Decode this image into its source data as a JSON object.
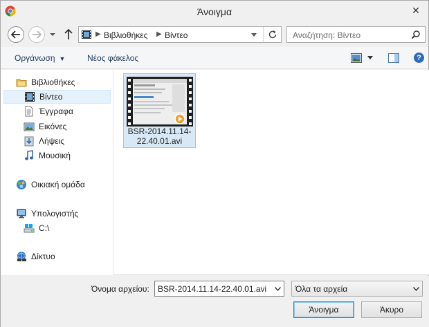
{
  "window": {
    "title": "Άνοιγμα",
    "app_icon": "chrome-icon",
    "close_icon": "close-icon"
  },
  "address_bar": {
    "segments": [
      "Βιβλιοθήκες",
      "Βίντεο"
    ],
    "location_icon": "video-library-icon"
  },
  "search": {
    "placeholder": "Αναζήτηση: Βίντεο"
  },
  "toolbar": {
    "organize_label": "Οργάνωση",
    "new_folder_label": "Νέος φάκελος"
  },
  "sidebar": {
    "items": [
      {
        "label": "Βιβλιοθήκες",
        "icon": "libraries-icon",
        "selected": false
      },
      {
        "label": "Βίντεο",
        "icon": "video-icon",
        "selected": true
      },
      {
        "label": "Έγγραφα",
        "icon": "documents-icon",
        "selected": false
      },
      {
        "label": "Εικόνες",
        "icon": "pictures-icon",
        "selected": false
      },
      {
        "label": "Λήψεις",
        "icon": "downloads-icon",
        "selected": false
      },
      {
        "label": "Μουσική",
        "icon": "music-icon",
        "selected": false
      },
      {
        "label": "Οικιακή ομάδα",
        "icon": "homegroup-icon",
        "selected": false
      },
      {
        "label": "Υπολογιστής",
        "icon": "computer-icon",
        "selected": false
      },
      {
        "label": "C:\\",
        "icon": "drive-icon",
        "selected": false
      },
      {
        "label": "Δίκτυο",
        "icon": "network-icon",
        "selected": false
      }
    ]
  },
  "files": [
    {
      "name": "BSR-2014.11.14-22.40.01.avi",
      "icon": "video-thumbnail"
    }
  ],
  "bottom": {
    "filename_label": "Όνομα αρχείου:",
    "filename_value": "BSR-2014.11.14-22.40.01.avi",
    "filetype_value": "Όλα τα αρχεία",
    "open_label": "Άνοιγμα",
    "cancel_label": "Άκυρο"
  },
  "colors": {
    "selection": "#e5f1fb",
    "tile_selected": "#d9e8f6",
    "accent_text": "#1e3a5f"
  }
}
